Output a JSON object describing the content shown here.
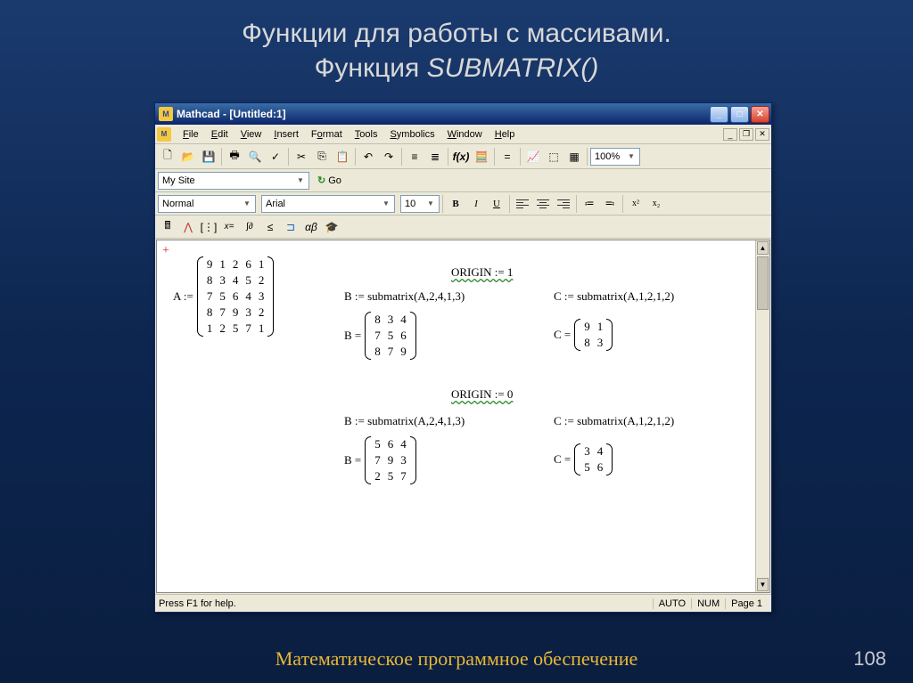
{
  "slide": {
    "title_line1": "Функции для работы с массивами.",
    "title_line2_prefix": "Функция ",
    "title_line2_func": "SUBMATRIX()",
    "footer": "Математическое программное обеспечение",
    "page": "108"
  },
  "window": {
    "title": "Mathcad - [Untitled:1]",
    "menu": [
      "File",
      "Edit",
      "View",
      "Insert",
      "Format",
      "Tools",
      "Symbolics",
      "Window",
      "Help"
    ],
    "combo_site": "My Site",
    "go_label": "Go",
    "style_combo": "Normal",
    "font_combo": "Arial",
    "size_combo": "10",
    "zoom_combo": "100%",
    "status_left": "Press F1 for help.",
    "status_auto": "AUTO",
    "status_num": "NUM",
    "status_page": "Page 1"
  },
  "worksheet": {
    "origin1": "ORIGIN := 1",
    "origin0": "ORIGIN := 0",
    "A_label": "A :=",
    "A_matrix": [
      [
        9,
        1,
        2,
        6,
        1
      ],
      [
        8,
        3,
        4,
        5,
        2
      ],
      [
        7,
        5,
        6,
        4,
        3
      ],
      [
        8,
        7,
        9,
        3,
        2
      ],
      [
        1,
        2,
        5,
        7,
        1
      ]
    ],
    "B_assign": "B := submatrix(A,2,4,1,3)",
    "B1_label": "B =",
    "B1_matrix": [
      [
        8,
        3,
        4
      ],
      [
        7,
        5,
        6
      ],
      [
        8,
        7,
        9
      ]
    ],
    "B2_label": "B =",
    "B2_matrix": [
      [
        5,
        6,
        4
      ],
      [
        7,
        9,
        3
      ],
      [
        2,
        5,
        7
      ]
    ],
    "C_assign1": "C := submatrix(A,1,2,1,2)",
    "C1_label": "C =",
    "C1_matrix": [
      [
        9,
        1
      ],
      [
        8,
        3
      ]
    ],
    "C_assign2": "C := submatrix(A,1,2,1,2)",
    "C2_label": "C =",
    "C2_matrix": [
      [
        3,
        4
      ],
      [
        5,
        6
      ]
    ]
  }
}
